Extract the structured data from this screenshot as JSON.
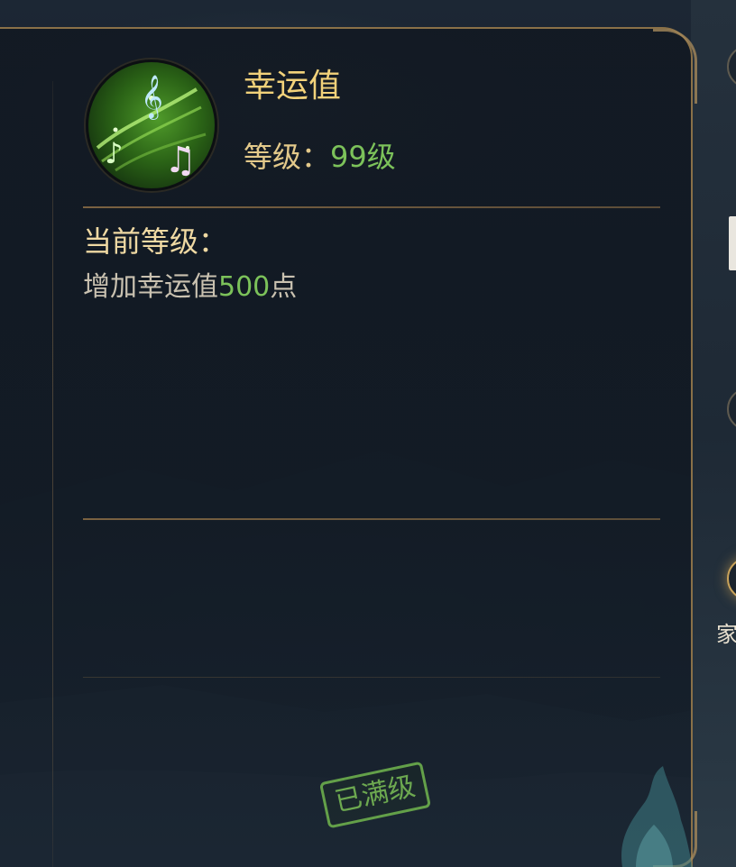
{
  "skill": {
    "icon": "music-notes-icon",
    "name": "幸运值",
    "level_label": "等级：",
    "level_value": "99级"
  },
  "current_level": {
    "heading": "当前等级：",
    "effect_prefix": "增加幸运值",
    "effect_value": "500",
    "effect_suffix": "点"
  },
  "status_stamp": "已满级",
  "side_panel": {
    "visible_label_char": "家"
  },
  "colors": {
    "title_gold": "#f2d27a",
    "label_gold": "#e3c98a",
    "value_green": "#7cc25a",
    "border_bronze": "#8a7148"
  }
}
